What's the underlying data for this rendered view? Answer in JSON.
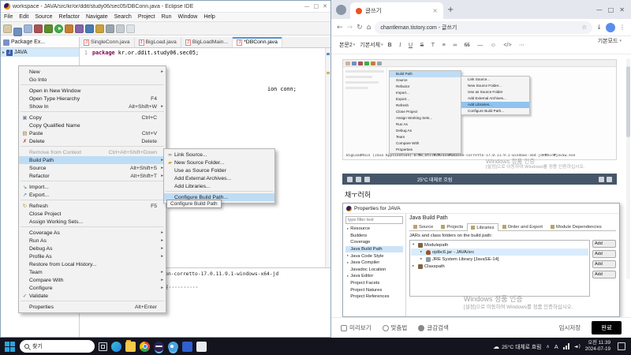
{
  "eclipse": {
    "title": "workspace - JAVA/src/kr/or/ddit/study06/sec05/DBConn.java - Eclipse IDE",
    "menu": [
      "File",
      "Edit",
      "Source",
      "Refactor",
      "Navigate",
      "Search",
      "Project",
      "Run",
      "Window",
      "Help"
    ],
    "explorer_tab": "Package Ex...",
    "project": "JAVA",
    "tabs": [
      {
        "label": "SingleConn.java"
      },
      {
        "label": "BigLoad.java"
      },
      {
        "label": "BigLoadMain..."
      },
      {
        "label": "*DBConn.java",
        "active": true
      }
    ],
    "gutter": "1",
    "code_keyword": "package",
    "code_rest": " kr.or.ddit.study06.sec05;",
    "code_fragment": "ion conn;",
    "console_line1": "ation] D:₩8_Util₩2₩Java₩amazon-corretto-17.0.11.9.1-windows-x64-jd",
    "console_line2": "··········포도윤··········포도윤··········",
    "context_menu": [
      {
        "label": "New",
        "arrow": true
      },
      {
        "label": "Go Into",
        "sep": true
      },
      {
        "label": "Open in New Window"
      },
      {
        "label": "Open Type Hierarchy",
        "shortcut": "F4"
      },
      {
        "label": "Show In",
        "shortcut": "Alt+Shift+W",
        "arrow": true,
        "sep": true
      },
      {
        "label": "Copy",
        "shortcut": "Ctrl+C",
        "icon": "copy"
      },
      {
        "label": "Copy Qualified Name"
      },
      {
        "label": "Paste",
        "shortcut": "Ctrl+V",
        "icon": "paste"
      },
      {
        "label": "Delete",
        "shortcut": "Delete",
        "icon": "delete",
        "sep": true
      },
      {
        "label": "Remove from Context",
        "shortcut": "Ctrl+Alt+Shift+Down",
        "disabled": true
      },
      {
        "label": "Build Path",
        "arrow": true,
        "hl": true
      },
      {
        "label": "Source",
        "shortcut": "Alt+Shift+S",
        "arrow": true
      },
      {
        "label": "Refactor",
        "shortcut": "Alt+Shift+T",
        "arrow": true,
        "sep": true
      },
      {
        "label": "Import...",
        "icon": "import"
      },
      {
        "label": "Export...",
        "icon": "export",
        "sep": true
      },
      {
        "label": "Refresh",
        "shortcut": "F5",
        "icon": "refresh"
      },
      {
        "label": "Close Project"
      },
      {
        "label": "Assign Working Sets...",
        "sep": true
      },
      {
        "label": "Coverage As",
        "arrow": true
      },
      {
        "label": "Run As",
        "arrow": true
      },
      {
        "label": "Debug As",
        "arrow": true
      },
      {
        "label": "Profile As",
        "arrow": true
      },
      {
        "label": "Restore from Local History..."
      },
      {
        "label": "Team",
        "arrow": true
      },
      {
        "label": "Compare With",
        "arrow": true
      },
      {
        "label": "Configure",
        "arrow": true
      },
      {
        "label": "Validate",
        "icon": "validate",
        "sep": true
      },
      {
        "label": "Properties",
        "shortcut": "Alt+Enter"
      }
    ],
    "submenu": [
      {
        "label": "Link Source...",
        "icon": "link"
      },
      {
        "label": "New Source Folder...",
        "icon": "folder"
      },
      {
        "label": "Use as Source Folder"
      },
      {
        "label": "Add External Archives..."
      },
      {
        "label": "Add Libraries...",
        "sep": true
      },
      {
        "label": "Configure Build Path...",
        "hl": true
      }
    ],
    "tooltip": "Configure Build Path"
  },
  "browser": {
    "tab_title": "글쓰기",
    "url": "chantleman.tistory.com - 글쓰기",
    "format_toolbar": [
      {
        "g": "본문2",
        "n": "paragraph-style-select",
        "dd": true
      },
      {
        "g": "기본서체",
        "n": "font-family-select",
        "dd": true
      },
      {
        "g": "B",
        "n": "bold-button"
      },
      {
        "g": "I",
        "n": "italic-button"
      },
      {
        "g": "U",
        "n": "underline-button"
      },
      {
        "g": "S",
        "n": "strikethrough-button"
      },
      {
        "g": "T",
        "n": "text-color-button"
      },
      {
        "g": "≡",
        "n": "align-button"
      },
      {
        "g": "∞",
        "n": "link-button"
      },
      {
        "g": "66",
        "n": "quote-button"
      },
      {
        "g": "—",
        "n": "horizontal-rule-button"
      },
      {
        "g": "☺",
        "n": "emoji-button"
      },
      {
        "g": "</>",
        "n": "code-block-button"
      },
      {
        "g": "⋯",
        "n": "more-button"
      }
    ],
    "mode": "기본모드",
    "post": {
      "shot1_menu": [
        {
          "label": "Build Path",
          "hl": true
        },
        {
          "label": "Source"
        },
        {
          "label": "Refactor"
        },
        {
          "label": "Import..."
        },
        {
          "label": "Export..."
        },
        {
          "label": "Refresh"
        },
        {
          "label": "Close Project"
        },
        {
          "label": "Assign Working Sets..."
        },
        {
          "label": "Run As"
        },
        {
          "label": "Debug As"
        },
        {
          "label": "Team"
        },
        {
          "label": "Compare With"
        },
        {
          "label": "Properties"
        }
      ],
      "shot1_sub": [
        {
          "label": "Link Source..."
        },
        {
          "label": "New Source Folder..."
        },
        {
          "label": "Use as Source Folder"
        },
        {
          "label": "Add External Archives..."
        },
        {
          "label": "Add Libraries...",
          "hl": true
        },
        {
          "label": "Configure Build Path..."
        }
      ],
      "shot1_caption": "BigLoadMain [Java Application] D:₩8_Util₩2₩Java₩amazon-corretto-17.0.11.9.1-windows-x64-jdk₩bin₩javaw.exe",
      "watermark_title": "Windows 정품 인증",
      "watermark_line": "[설정]으로 이동하여 Windows를 정품 인증하십시오.",
      "strip_weather": "25°C 대체로 흐림",
      "user_text": "채ㅜ러허",
      "dialog": {
        "title": "Properties for JAVA",
        "filter": "type filter text",
        "nav": [
          {
            "label": "Resource",
            "exp": true
          },
          {
            "label": "Builders"
          },
          {
            "label": "Coverage"
          },
          {
            "label": "Java Build Path",
            "sel": true
          },
          {
            "label": "Java Code Style",
            "exp": true
          },
          {
            "label": "Java Compiler",
            "exp": true
          },
          {
            "label": "Javadoc Location"
          },
          {
            "label": "Java Editor",
            "exp": true
          },
          {
            "label": "Project Facets"
          },
          {
            "label": "Project Natures"
          },
          {
            "label": "Project References"
          }
        ],
        "heading": "Java Build Path",
        "tabs": [
          {
            "label": "Source"
          },
          {
            "label": "Projects"
          },
          {
            "label": "Libraries",
            "active": true
          },
          {
            "label": "Order and Export"
          },
          {
            "label": "Module Dependencies"
          }
        ],
        "desc": "JARs and class folders on the build path:",
        "tree": [
          {
            "label": "Modulepath",
            "exp": "▾",
            "icon": "module"
          },
          {
            "label": "ojdbc6.jar - JAVA/src",
            "exp": "▸",
            "icon": "jar",
            "lv": true,
            "sel": true
          },
          {
            "label": "JRE System Library [JavaSE-14]",
            "exp": "▸",
            "icon": "lib",
            "lv": true
          },
          {
            "label": "Classpath",
            "exp": "▸",
            "icon": "module"
          }
        ],
        "buttons": [
          "Add",
          "Add",
          "Add",
          "Add"
        ]
      }
    },
    "bottom_bar": {
      "preview": "미리보기",
      "spell": "맞춤법",
      "material": "글감검색",
      "temp_save": "임시저장",
      "done": "완료"
    }
  },
  "taskbar": {
    "search": "찾기",
    "weather": "25°C 대체로 흐림",
    "ime": "A",
    "time_line1": "오전 11:39",
    "time_line2": "2024-07-19"
  }
}
